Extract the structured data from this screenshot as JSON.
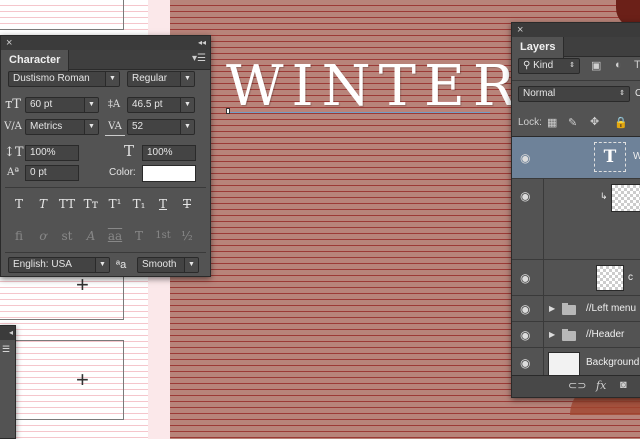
{
  "canvas": {
    "headline": "WINTER"
  },
  "character_panel": {
    "tab_label": "Character",
    "font_family": "Dustismo Roman",
    "font_style": "Regular",
    "font_size": "60 pt",
    "leading": "46.5 pt",
    "kerning": "Metrics",
    "tracking": "52",
    "vertical_scale": "100%",
    "horizontal_scale": "100%",
    "baseline_shift": "0 pt",
    "color_label": "Color:",
    "color_value": "#ffffff",
    "style_buttons": [
      "T",
      "T",
      "TT",
      "Tт",
      "T¹",
      "T₁",
      "T",
      "T"
    ],
    "opentype_buttons": [
      "fi",
      "ơ",
      "st",
      "A",
      "aa",
      "T",
      "1st",
      "½"
    ],
    "language": "English: USA",
    "aa_symbol": "ªa",
    "antialias": "Smooth"
  },
  "layers_panel": {
    "tab_label": "Layers",
    "filter_kind": "Kind",
    "blend_mode": "Normal",
    "opacity_initial": "O",
    "lock_label": "Lock:",
    "layers": [
      {
        "name": "W",
        "type": "text",
        "selected": true
      },
      {
        "name": "",
        "type": "smart-clip",
        "selected": false
      },
      {
        "name": "c",
        "type": "image",
        "selected": false
      },
      {
        "name": "//Left menu",
        "type": "group",
        "selected": false
      },
      {
        "name": "//Header",
        "type": "group",
        "selected": false
      },
      {
        "name": "Background",
        "type": "background",
        "selected": false
      }
    ]
  }
}
